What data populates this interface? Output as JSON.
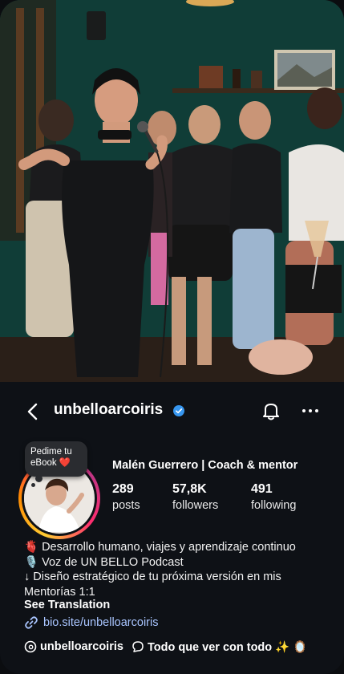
{
  "profile": {
    "username": "unbelloarcoiris",
    "display_name": "Malén Guerrero | Coach & mentor",
    "note": "Pedime tu eBook ❤️",
    "stats": [
      {
        "value": "289",
        "label": "posts"
      },
      {
        "value": "57,8K",
        "label": "followers"
      },
      {
        "value": "491",
        "label": "following"
      }
    ],
    "bio": [
      "🫀 Desarrollo humano, viajes y aprendizaje continuo",
      "🎙️ Voz de UN BELLO Podcast",
      "↓ Diseño estratégico de tu próxima versión en mis",
      "Mentorías 1:1"
    ],
    "see_translation": "See Translation",
    "link": "bio.site/unbelloarcoiris",
    "threads_handle": "unbelloarcoiris",
    "thread_topic": "Todo que ver con todo ✨ 🪞"
  },
  "icons": {
    "back": "chevron-left-icon",
    "verified": "verified-badge-icon",
    "notifications": "bell-icon",
    "more": "more-horizontal-icon",
    "link": "link-icon",
    "threads": "threads-icon",
    "chat": "chat-bubble-icon"
  },
  "colors": {
    "background": "#0e1116",
    "verified": "#3797f0",
    "link": "#a9c5ff",
    "story_ring_start": "#ffcc33",
    "story_ring_end": "#c13584"
  }
}
